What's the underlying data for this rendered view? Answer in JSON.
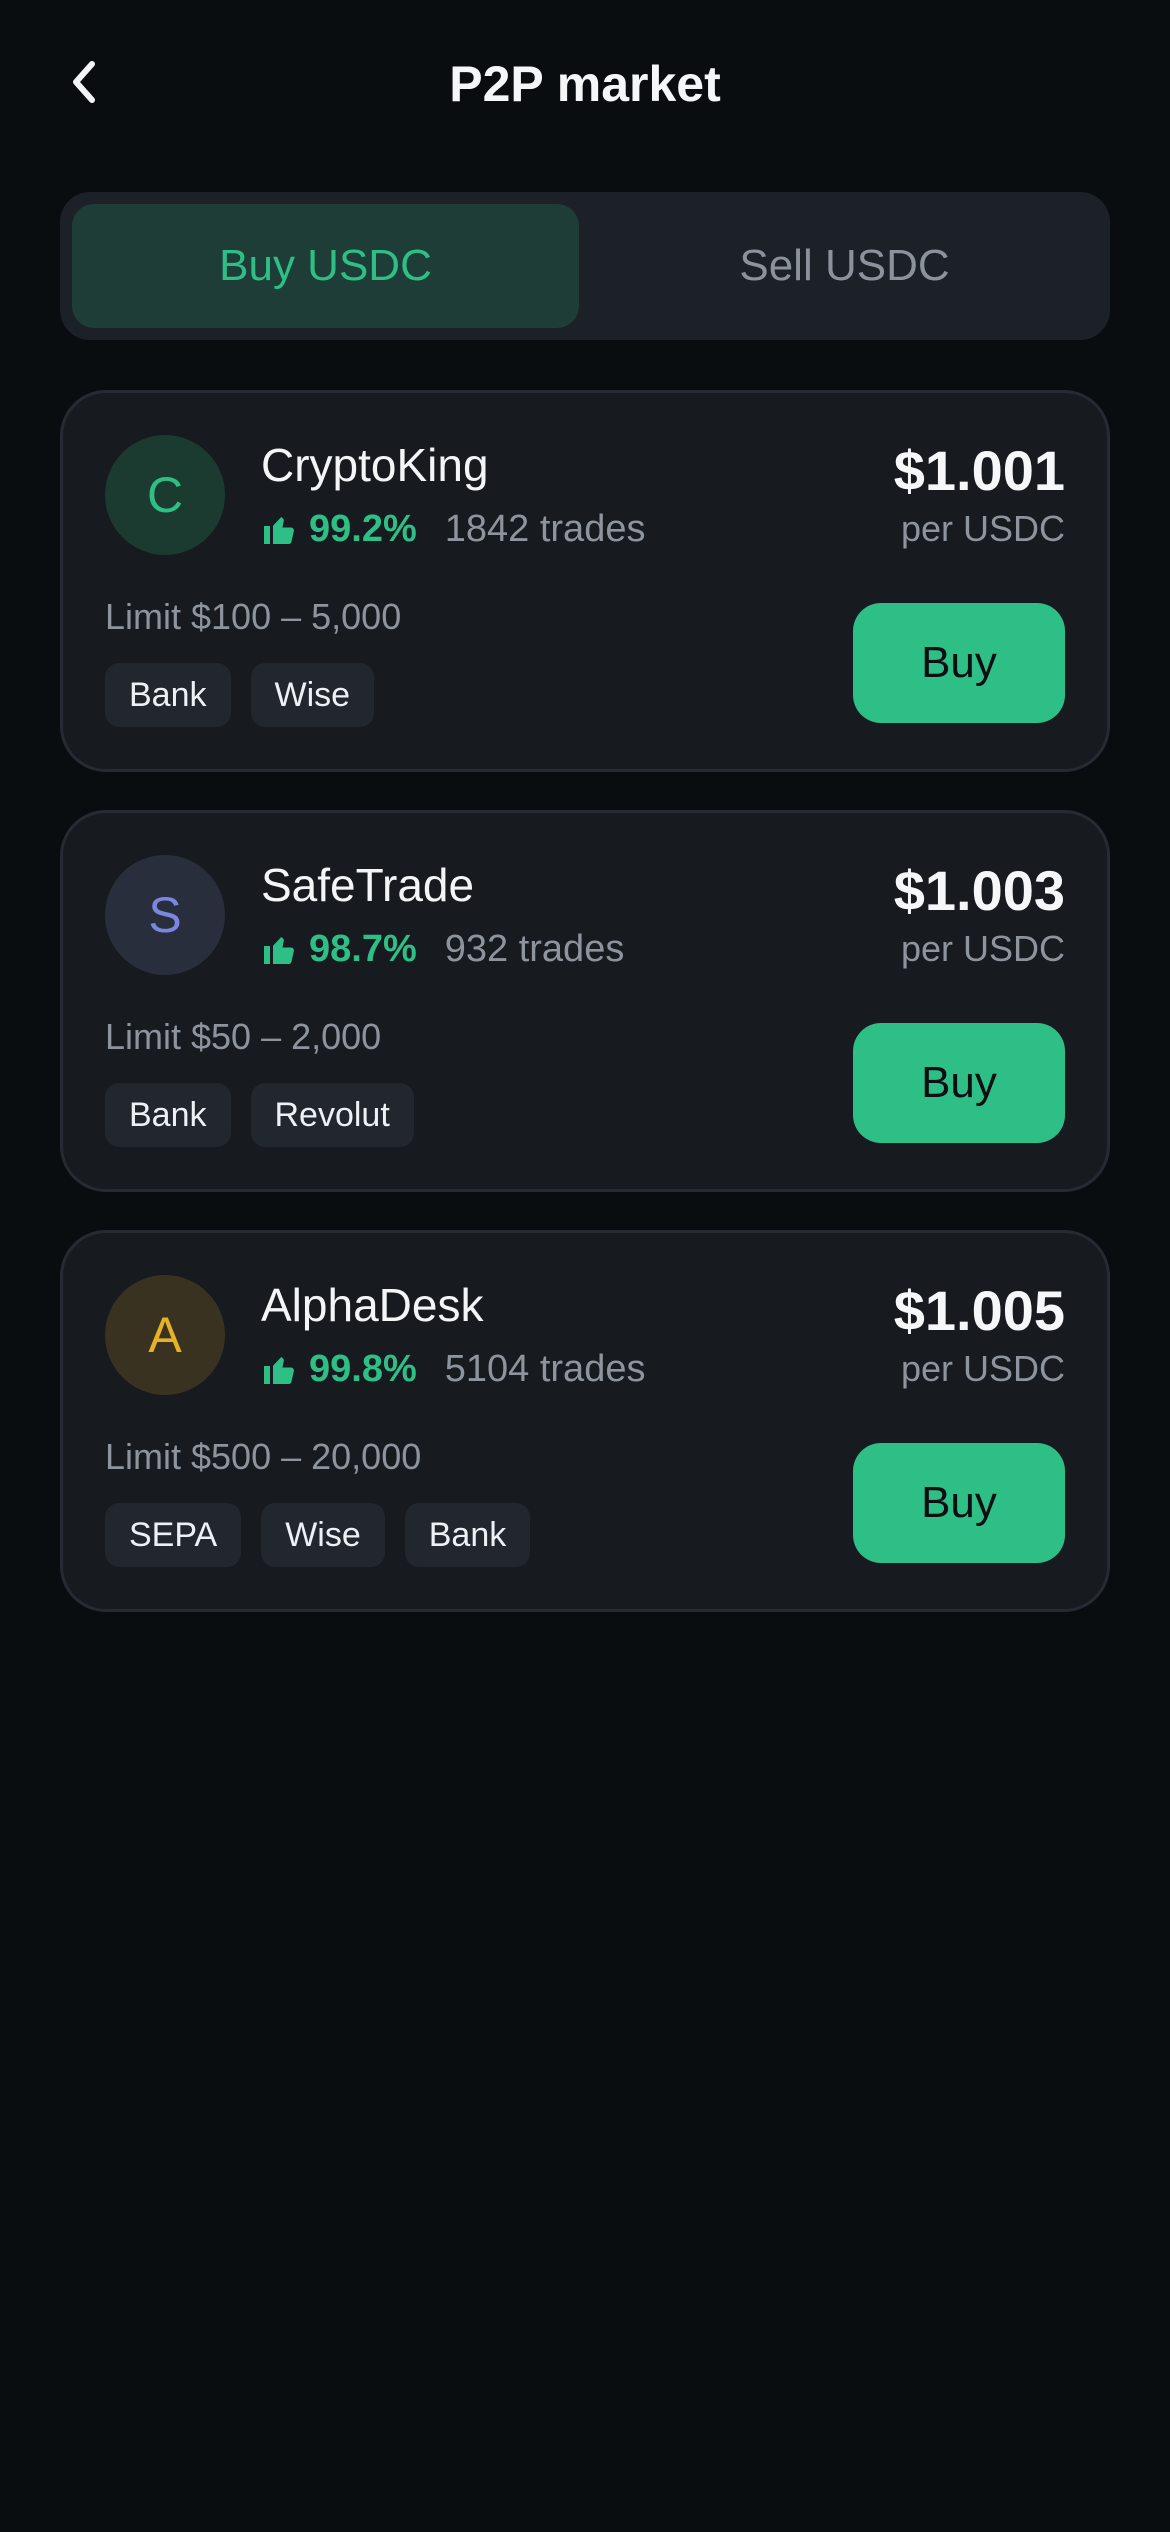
{
  "header": {
    "title": "P2P market",
    "back_icon": "chevron-left-icon"
  },
  "tabs": {
    "buy_label": "Buy USDC",
    "sell_label": "Sell USDC",
    "active": "buy"
  },
  "colors": {
    "accent": "#2ebf87",
    "background": "#0a0d10",
    "card": "#171a1f",
    "muted_text": "#8d949e"
  },
  "offers": [
    {
      "avatar_letter": "C",
      "avatar_color": "#2ebf87",
      "avatar_bg": "#1b3a30",
      "name": "CryptoKing",
      "rating": "99.2%",
      "trades": "1842 trades",
      "price": "$1.001",
      "price_unit": "per USDC",
      "limit": "Limit $100 – 5,000",
      "methods": [
        "Bank",
        "Wise"
      ],
      "button_label": "Buy"
    },
    {
      "avatar_letter": "S",
      "avatar_color": "#7a86e0",
      "avatar_bg": "#292e3c",
      "name": "SafeTrade",
      "rating": "98.7%",
      "trades": "932 trades",
      "price": "$1.003",
      "price_unit": "per USDC",
      "limit": "Limit $50 – 2,000",
      "methods": [
        "Bank",
        "Revolut"
      ],
      "button_label": "Buy"
    },
    {
      "avatar_letter": "A",
      "avatar_color": "#e5b125",
      "avatar_bg": "#3a3220",
      "name": "AlphaDesk",
      "rating": "99.8%",
      "trades": "5104 trades",
      "price": "$1.005",
      "price_unit": "per USDC",
      "limit": "Limit $500 – 20,000",
      "methods": [
        "SEPA",
        "Wise",
        "Bank"
      ],
      "button_label": "Buy"
    }
  ]
}
